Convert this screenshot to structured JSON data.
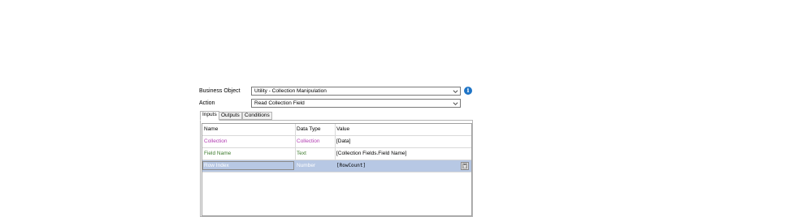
{
  "form": {
    "business_object_label": "Business Object",
    "business_object_value": "Utility - Collection Manipulation",
    "action_label": "Action",
    "action_value": "Read Collection Field",
    "info_glyph": "i"
  },
  "tabs": [
    {
      "label": "Inputs",
      "active": true
    },
    {
      "label": "Outputs",
      "active": false
    },
    {
      "label": "Conditions",
      "active": false
    }
  ],
  "grid": {
    "columns": [
      "Name",
      "Data Type",
      "Value"
    ],
    "rows": [
      {
        "name": "Collection",
        "type": "Collection",
        "value": "[Data]",
        "color": "#b13bb1"
      },
      {
        "name": "Field Name",
        "type": "Text",
        "value": "[Collection Fields.Field Name]",
        "color": "#3c7a2c"
      },
      {
        "name": "Row Index",
        "type": "Number",
        "value": "[RowCount]",
        "color": "#ffffff",
        "selected": true
      }
    ]
  },
  "icons": {
    "dropdown": "chevron-down-icon",
    "info": "info-icon",
    "expression": "calculator-icon"
  },
  "colors": {
    "selection": "#b7c8e4",
    "collection_type": "#b13bb1",
    "text_type": "#3c7a2c",
    "info_blue": "#1e74c6"
  }
}
